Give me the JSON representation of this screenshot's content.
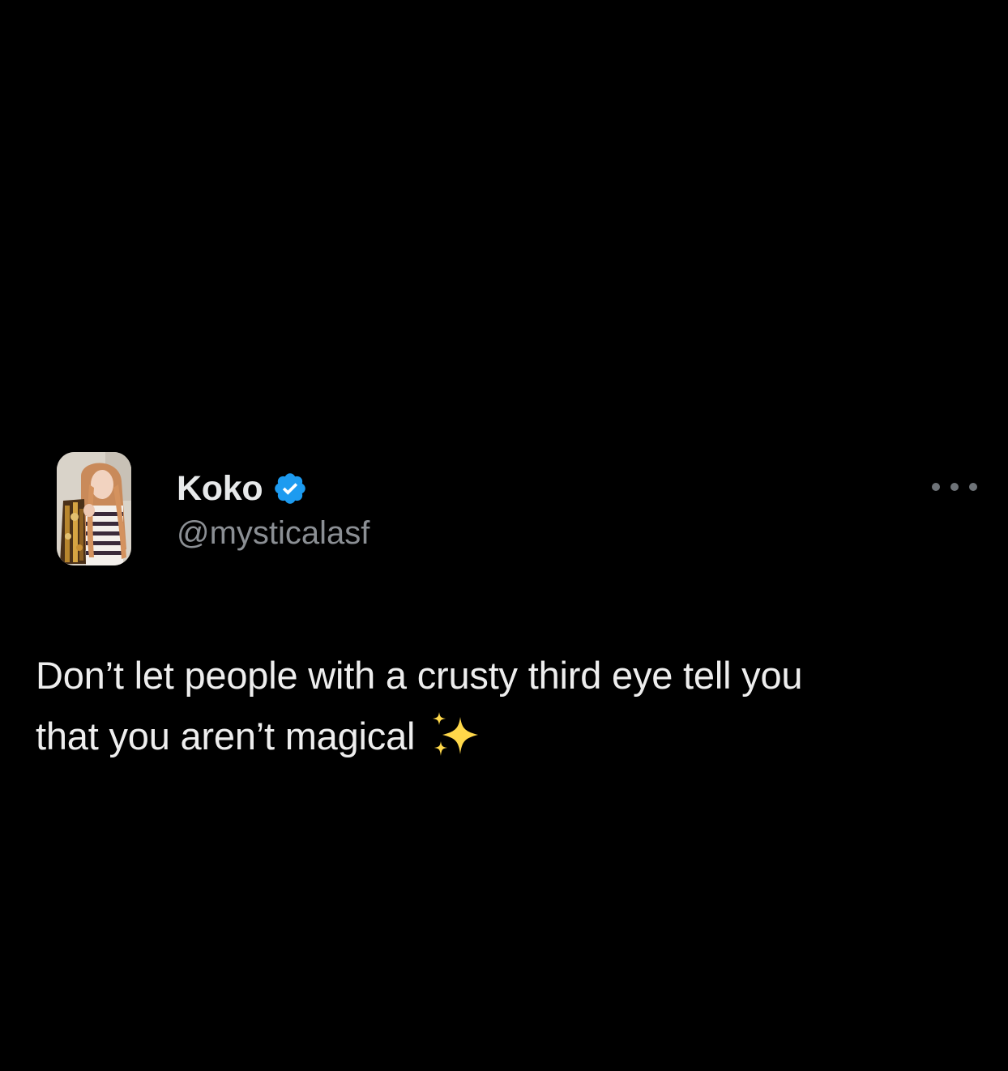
{
  "author": {
    "display_name": "Koko",
    "handle": "@mysticalasf",
    "verified": true,
    "verified_icon": "verified-badge-icon",
    "avatar": "profile-photo"
  },
  "tweet": {
    "text_line_1": "Don’t let people with a crusty third eye tell you",
    "text_line_2": "that you aren’t magical",
    "emoji": "sparkles-emoji"
  },
  "menu": {
    "icon": "more-options-icon"
  },
  "colors": {
    "background": "#000000",
    "text_primary": "#e7e9ea",
    "text_secondary": "#8b8f94",
    "verified_blue": "#1d9bf0",
    "sparkle_gold": "#ffd84a"
  }
}
